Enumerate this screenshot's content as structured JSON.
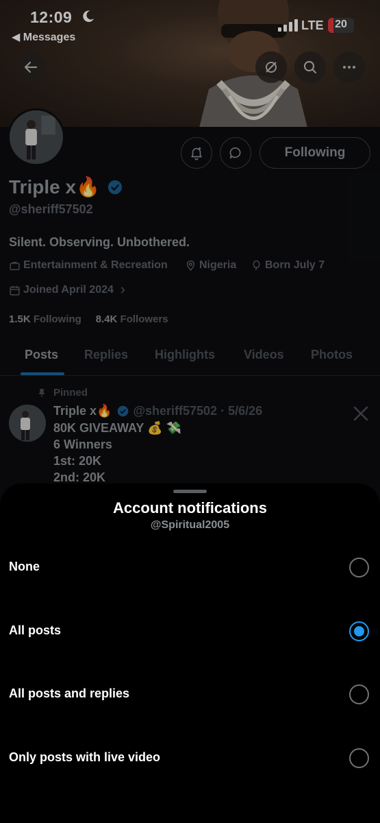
{
  "status_bar": {
    "time": "12:09",
    "back_app": "◀ Messages",
    "network": "LTE",
    "battery": "20",
    "battery_level": 0.2
  },
  "profile": {
    "name": "Triple x🔥",
    "handle": "@sheriff57502",
    "bio": "Silent. Observing. Unbothered.",
    "category": "Entertainment & Recreation",
    "location": "Nigeria",
    "born": "Born July 7",
    "joined": "Joined April 2024",
    "following_button": "Following",
    "following_count": "1.5K",
    "following_label": "Following",
    "followers_count": "8.4K",
    "followers_label": "Followers"
  },
  "tabs": [
    "Posts",
    "Replies",
    "Highlights",
    "Videos",
    "Photos"
  ],
  "pinned_post": {
    "pinned_label": "Pinned",
    "author": "Triple x🔥",
    "meta": "@sheriff57502 · 5/6/26",
    "lines": [
      "80K GIVEAWAY 💰 💸",
      "6 Winners",
      "1st:  20K",
      "2nd: 20K"
    ]
  },
  "sheet": {
    "title": "Account notifications",
    "subtitle": "@Spiritual2005",
    "options": [
      {
        "label": "None",
        "selected": false
      },
      {
        "label": "All posts",
        "selected": true
      },
      {
        "label": "All posts and replies",
        "selected": false
      },
      {
        "label": "Only posts with live video",
        "selected": false
      }
    ]
  },
  "colors": {
    "accent": "#1d9bf0",
    "sheet_background": "#000000",
    "battery_fill": "#e0383e"
  }
}
